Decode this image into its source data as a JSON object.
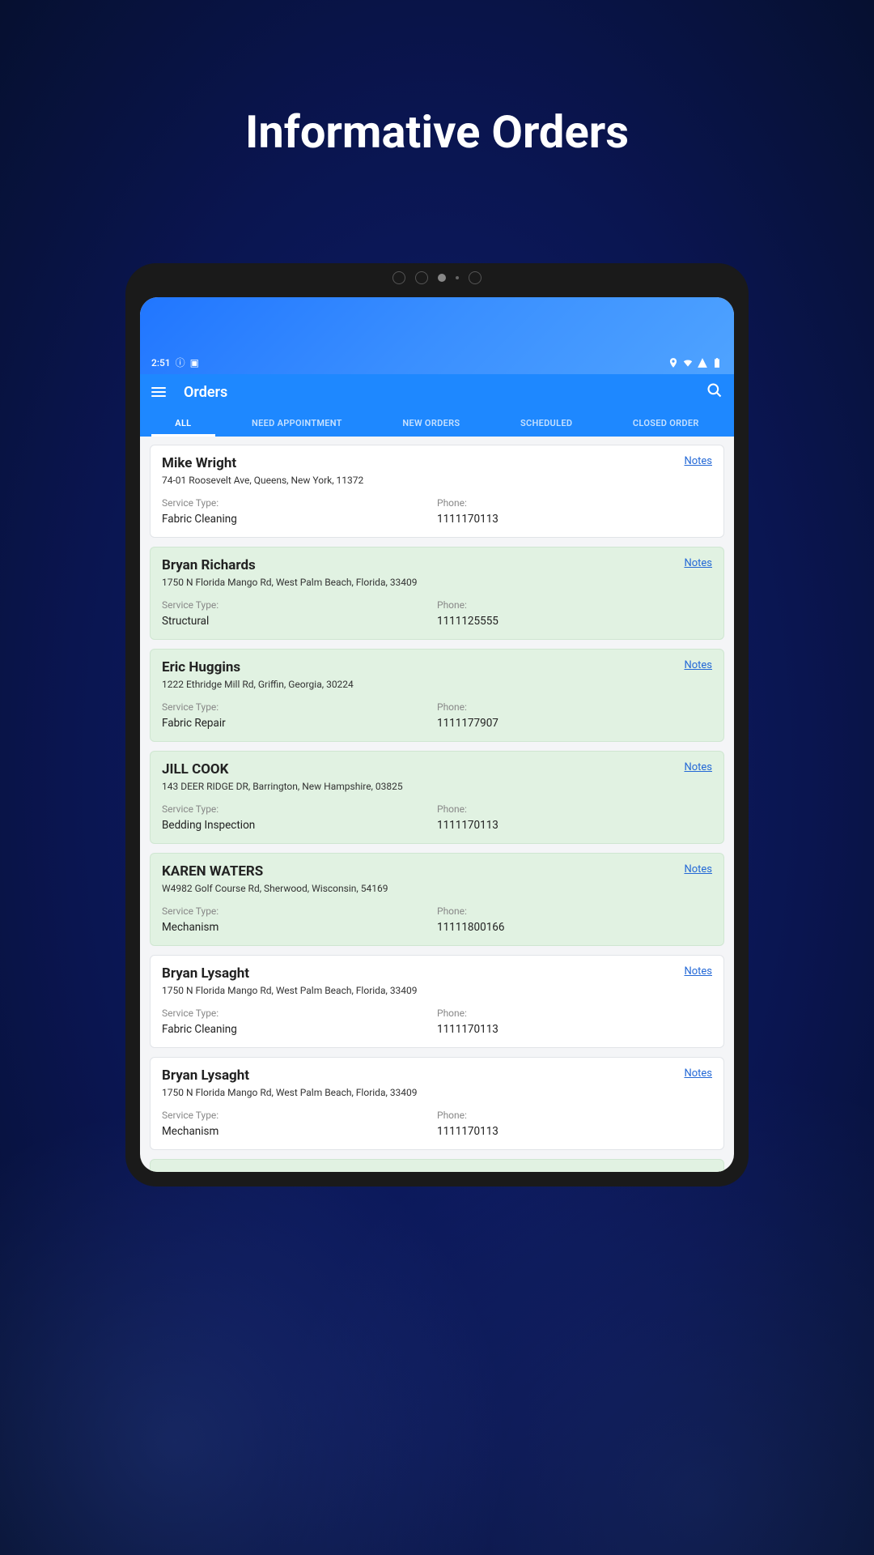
{
  "marketing_title": "Informative Orders",
  "status": {
    "time": "2:51",
    "icons_left": "ⓘ ◩"
  },
  "app": {
    "title": "Orders"
  },
  "tabs": [
    {
      "label": "ALL",
      "active": true
    },
    {
      "label": "NEED APPOINTMENT",
      "active": false
    },
    {
      "label": "NEW ORDERS",
      "active": false
    },
    {
      "label": "SCHEDULED",
      "active": false
    },
    {
      "label": "CLOSED ORDER",
      "active": false
    }
  ],
  "labels": {
    "service_type": "Service Type:",
    "phone": "Phone:",
    "notes": "Notes"
  },
  "orders": [
    {
      "name": "Mike Wright",
      "address": "74-01 Roosevelt Ave, Queens, New York, 11372",
      "service": "Fabric Cleaning",
      "phone": "1111170113",
      "green": false
    },
    {
      "name": "Bryan Richards",
      "address": "1750 N Florida Mango Rd, West Palm Beach, Florida, 33409",
      "service": "Structural",
      "phone": "1111125555",
      "green": true
    },
    {
      "name": "Eric Huggins",
      "address": "1222 Ethridge Mill Rd, Griffin, Georgia, 30224",
      "service": "Fabric Repair",
      "phone": "1111177907",
      "green": true
    },
    {
      "name": "JILL COOK",
      "address": "143 DEER RIDGE DR, Barrington, New Hampshire, 03825",
      "service": "Bedding Inspection",
      "phone": "1111170113",
      "green": true
    },
    {
      "name": "KAREN WATERS",
      "address": "W4982 Golf Course Rd, Sherwood, Wisconsin, 54169",
      "service": "Mechanism",
      "phone": "11111800166",
      "green": true
    },
    {
      "name": "Bryan Lysaght",
      "address": "1750 N Florida Mango Rd, West Palm Beach, Florida, 33409",
      "service": "Fabric Cleaning",
      "phone": "1111170113",
      "green": false
    },
    {
      "name": "Bryan Lysaght",
      "address": "1750 N Florida Mango Rd, West Palm Beach, Florida, 33409",
      "service": "Mechanism",
      "phone": "1111170113",
      "green": false
    }
  ]
}
